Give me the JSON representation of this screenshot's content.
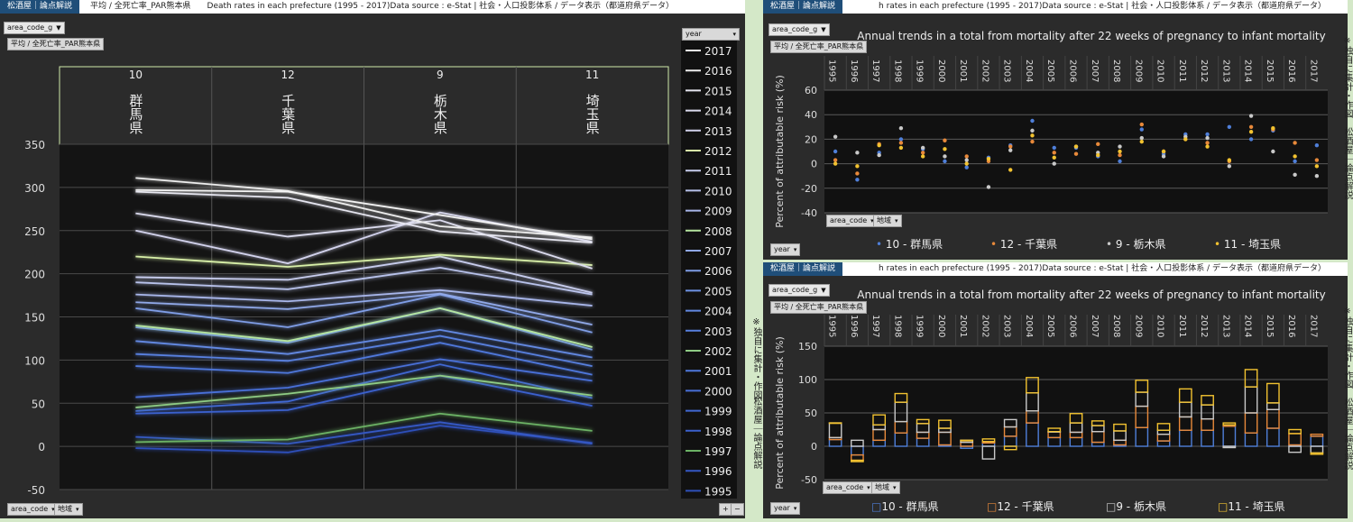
{
  "left": {
    "brand": "松酒屋｜論点解説",
    "header": "平均 / 全死亡率_PAR熊本県　　Death rates in each prefecture (1995 - 2017)Data source : e-Stat | 社会・人口投影体系 / データ表示（都道府県データ）",
    "filter_button": "area_code_g",
    "measure_button": "平均 / 全死亡率_PAR熊本県",
    "bottom_button_1": "area_code",
    "bottom_button_2": "地域",
    "legend_button": "year",
    "zoom_plus": "+",
    "zoom_minus": "−",
    "side_label_1": "※独自に集計・作図",
    "side_label_2": "松酒屋｜論点解説"
  },
  "right_top": {
    "brand": "松酒屋｜論点解説",
    "header": "h rates in each prefecture (1995 - 2017)Data source : e-Stat | 社会・人口投影体系 / データ表示（都道府県データ）",
    "filter_button": "area_code_g",
    "measure_button": "平均 / 全死亡率_PAR熊本県",
    "area_button": "area_code",
    "region_button": "地域",
    "year_button": "year",
    "side_label": "※独自に集計・作図　松酒屋｜論点解説",
    "legend": [
      "10 - 群馬県",
      "12 - 千葉県",
      "9 - 栃木県",
      "11 - 埼玉県"
    ]
  },
  "right_bottom": {
    "brand": "松酒屋｜論点解説",
    "header": "h rates in each prefecture (1995 - 2017)Data source : e-Stat | 社会・人口投影体系 / データ表示（都道府県データ）",
    "filter_button": "area_code_g",
    "measure_button": "平均 / 全死亡率_PAR熊本県",
    "area_button": "area_code",
    "region_button": "地域",
    "year_button": "year",
    "side_label": "※独自に集計・作図　松酒屋｜論点解説",
    "legend": [
      "10 - 群馬県",
      "12 - 千葉県",
      "9 - 栃木県",
      "11 - 埼玉県"
    ]
  },
  "colors": {
    "pref10": "#4f7fd9",
    "pref12": "#e8893a",
    "pref9": "#c9c9c9",
    "pref11": "#f2c230"
  },
  "chart_data": [
    {
      "type": "line",
      "title": "",
      "ylabel": "",
      "categories": [
        "10",
        "12",
        "9",
        "11"
      ],
      "category_labels": [
        "群馬県",
        "千葉県",
        "栃木県",
        "埼玉県"
      ],
      "ylim": [
        -50,
        350
      ],
      "yticks": [
        -50,
        0,
        50,
        100,
        150,
        200,
        250,
        300,
        350
      ],
      "legend_position": "right",
      "series": [
        {
          "name": "2017",
          "color": "#f4f4f4",
          "values": [
            297,
            295,
            268,
            240
          ]
        },
        {
          "name": "2016",
          "color": "#eeeeee",
          "values": [
            311,
            296,
            255,
            242
          ]
        },
        {
          "name": "2015",
          "color": "#e6e6f0",
          "values": [
            295,
            288,
            249,
            236
          ]
        },
        {
          "name": "2014",
          "color": "#dcdcef",
          "values": [
            270,
            243,
            262,
            206
          ]
        },
        {
          "name": "2013",
          "color": "#d2d2ec",
          "values": [
            250,
            212,
            271,
            237
          ]
        },
        {
          "name": "2012",
          "color": "#d8f0a8",
          "values": [
            220,
            208,
            222,
            210
          ]
        },
        {
          "name": "2011",
          "color": "#c8cdee",
          "values": [
            196,
            193,
            220,
            178
          ]
        },
        {
          "name": "2010",
          "color": "#b8c2eb",
          "values": [
            190,
            182,
            207,
            176
          ]
        },
        {
          "name": "2009",
          "color": "#a8b6ea",
          "values": [
            176,
            168,
            181,
            163
          ]
        },
        {
          "name": "2008",
          "color": "#b6e6a0",
          "values": [
            140,
            122,
            160,
            115
          ]
        },
        {
          "name": "2007",
          "color": "#90a8e8",
          "values": [
            167,
            159,
            177,
            141
          ]
        },
        {
          "name": "2006",
          "color": "#7f9de6",
          "values": [
            160,
            138,
            176,
            132
          ]
        },
        {
          "name": "2005",
          "color": "#6f93e5",
          "values": [
            138,
            120,
            160,
            112
          ]
        },
        {
          "name": "2004",
          "color": "#6389e2",
          "values": [
            122,
            107,
            135,
            103
          ]
        },
        {
          "name": "2003",
          "color": "#5880df",
          "values": [
            107,
            99,
            128,
            93
          ]
        },
        {
          "name": "2002",
          "color": "#8fcc85",
          "values": [
            45,
            61,
            82,
            59
          ]
        },
        {
          "name": "2001",
          "color": "#4f78dc",
          "values": [
            93,
            85,
            120,
            83
          ]
        },
        {
          "name": "2000",
          "color": "#4870d8",
          "values": [
            57,
            68,
            101,
            76
          ]
        },
        {
          "name": "1999",
          "color": "#4168d3",
          "values": [
            41,
            52,
            95,
            56
          ]
        },
        {
          "name": "1998",
          "color": "#3b61cd",
          "values": [
            38,
            42,
            82,
            47
          ]
        },
        {
          "name": "1997",
          "color": "#6cb265",
          "values": [
            5,
            8,
            38,
            18
          ]
        },
        {
          "name": "1996",
          "color": "#3458c4",
          "values": [
            11,
            3,
            28,
            3
          ]
        },
        {
          "name": "1995",
          "color": "#2f50ba",
          "values": [
            -2,
            -7,
            24,
            4
          ]
        }
      ]
    },
    {
      "type": "scatter",
      "title": "Annual trends in a total from mortality after 22 weeks of pregnancy to infant mortality",
      "ylabel": "Percent of attributable risk (%)",
      "ylim": [
        -40,
        60
      ],
      "yticks": [
        -40,
        -20,
        0,
        20,
        40,
        60
      ],
      "legend_position": "bottom",
      "categories": [
        "1995",
        "1996",
        "1997",
        "1998",
        "1999",
        "2000",
        "2001",
        "2002",
        "2003",
        "2004",
        "2005",
        "2006",
        "2007",
        "2008",
        "2009",
        "2010",
        "2011",
        "2012",
        "2013",
        "2014",
        "2015",
        "2016",
        "2017"
      ],
      "series": [
        {
          "name": "10 - 群馬県",
          "values": [
            10,
            -13,
            9,
            20,
            12,
            2,
            -3,
            5,
            15,
            35,
            13,
            13,
            6,
            2,
            28,
            8,
            24,
            24,
            30,
            20,
            27,
            2,
            15
          ]
        },
        {
          "name": "12 - 千葉県",
          "values": [
            3,
            -8,
            16,
            17,
            9,
            19,
            6,
            2,
            14,
            18,
            9,
            8,
            16,
            7,
            32,
            10,
            20,
            17,
            2,
            30,
            28,
            17,
            3
          ]
        },
        {
          "name": "9 - 栃木県",
          "values": [
            22,
            9,
            7,
            29,
            13,
            6,
            3,
            -19,
            11,
            27,
            0,
            14,
            9,
            14,
            21,
            6,
            22,
            21,
            -2,
            39,
            10,
            -9,
            -10
          ]
        },
        {
          "name": "11 - 埼玉県",
          "values": [
            0,
            -2,
            15,
            13,
            6,
            12,
            0,
            4,
            -5,
            23,
            5,
            14,
            7,
            10,
            18,
            10,
            20,
            14,
            3,
            26,
            29,
            6,
            -2
          ]
        }
      ]
    },
    {
      "type": "bar",
      "stacked": true,
      "title": "Annual trends in a total from mortality after 22 weeks of pregnancy to infant mortality",
      "ylabel": "Percent of attributable risk (%)",
      "ylim": [
        -50,
        150
      ],
      "yticks": [
        -50,
        0,
        50,
        100,
        150
      ],
      "legend_position": "bottom",
      "categories": [
        "1995",
        "1996",
        "1997",
        "1998",
        "1999",
        "2000",
        "2001",
        "2002",
        "2003",
        "2004",
        "2005",
        "2006",
        "2007",
        "2008",
        "2009",
        "2010",
        "2011",
        "2012",
        "2013",
        "2014",
        "2015",
        "2016",
        "2017"
      ],
      "series": [
        {
          "name": "10 - 群馬県",
          "values": [
            10,
            -13,
            9,
            20,
            12,
            2,
            -3,
            5,
            15,
            35,
            13,
            13,
            6,
            2,
            28,
            8,
            24,
            24,
            30,
            20,
            27,
            2,
            15
          ]
        },
        {
          "name": "12 - 千葉県",
          "values": [
            3,
            -8,
            16,
            17,
            9,
            19,
            6,
            2,
            14,
            18,
            9,
            8,
            16,
            7,
            32,
            10,
            20,
            17,
            2,
            30,
            28,
            17,
            3
          ]
        },
        {
          "name": "9 - 栃木県",
          "values": [
            22,
            9,
            7,
            29,
            13,
            6,
            3,
            -19,
            11,
            27,
            0,
            14,
            9,
            14,
            21,
            6,
            22,
            21,
            -2,
            39,
            10,
            -9,
            -10
          ]
        },
        {
          "name": "11 - 埼玉県",
          "values": [
            0,
            -2,
            15,
            13,
            6,
            12,
            0,
            4,
            -5,
            23,
            5,
            14,
            7,
            10,
            18,
            10,
            20,
            14,
            3,
            26,
            29,
            6,
            -2
          ]
        }
      ]
    }
  ]
}
